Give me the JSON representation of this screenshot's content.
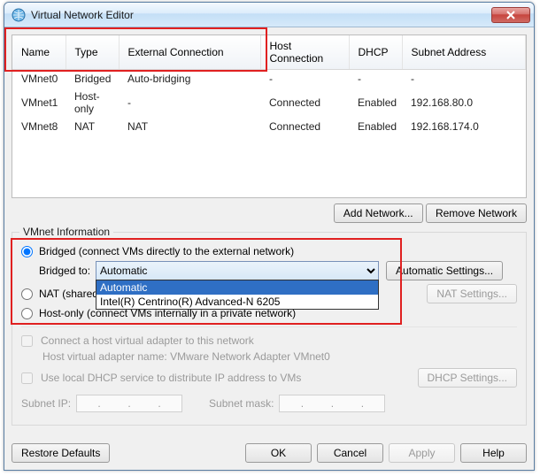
{
  "window": {
    "title": "Virtual Network Editor"
  },
  "table": {
    "headers": {
      "name": "Name",
      "type": "Type",
      "ext": "External Connection",
      "host": "Host Connection",
      "dhcp": "DHCP",
      "subnet": "Subnet Address"
    },
    "rows": [
      {
        "name": "VMnet0",
        "type": "Bridged",
        "ext": "Auto-bridging",
        "host": "-",
        "dhcp": "-",
        "subnet": "-"
      },
      {
        "name": "VMnet1",
        "type": "Host-only",
        "ext": "-",
        "host": "Connected",
        "dhcp": "Enabled",
        "subnet": "192.168.80.0"
      },
      {
        "name": "VMnet8",
        "type": "NAT",
        "ext": "NAT",
        "host": "Connected",
        "dhcp": "Enabled",
        "subnet": "192.168.174.0"
      }
    ]
  },
  "buttons": {
    "add_network": "Add Network...",
    "remove_network": "Remove Network",
    "automatic_settings": "Automatic Settings...",
    "nat_settings": "NAT Settings...",
    "dhcp_settings": "DHCP Settings...",
    "restore_defaults": "Restore Defaults",
    "ok": "OK",
    "cancel": "Cancel",
    "apply": "Apply",
    "help": "Help"
  },
  "group": {
    "legend": "VMnet Information",
    "bridged_label": "Bridged (connect VMs directly to the external network)",
    "bridged_to_label": "Bridged to:",
    "bridged_selected": "Automatic",
    "dropdown_options": [
      "Automatic",
      "Intel(R) Centrino(R) Advanced-N 6205"
    ],
    "nat_label": "NAT (shared",
    "hostonly_label": "Host-only (connect VMs internally in a private network)",
    "host_adapter_check": "Connect a host virtual adapter to this network",
    "host_adapter_hint": "Host virtual adapter name: VMware Network Adapter VMnet0",
    "dhcp_check": "Use local DHCP service to distribute IP address to VMs",
    "subnet_ip_label": "Subnet IP:",
    "subnet_mask_label": "Subnet mask:"
  },
  "colors": {
    "highlight": "#e02020",
    "select": "#2f6fc4"
  }
}
